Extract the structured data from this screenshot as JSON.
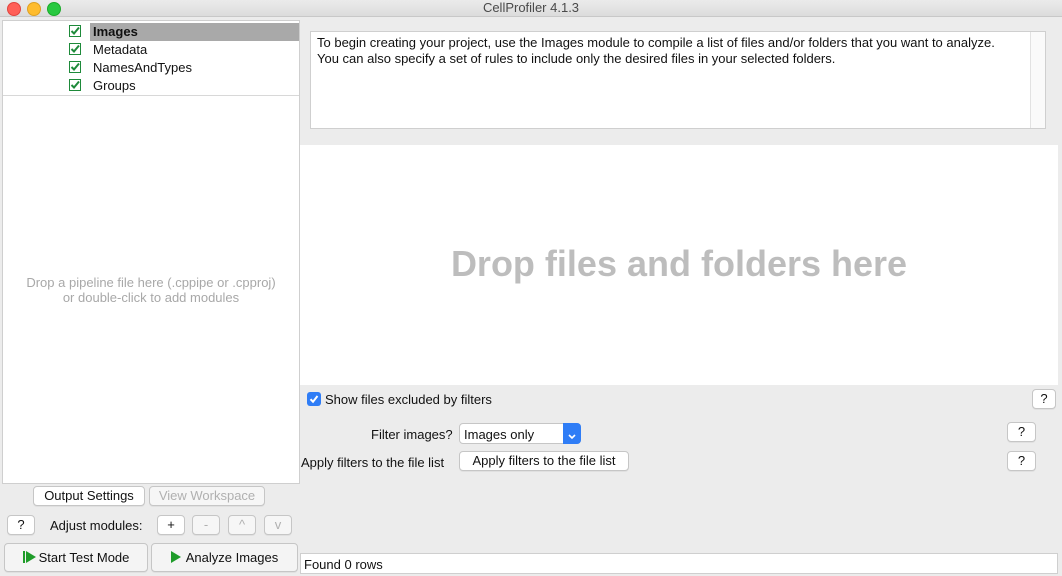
{
  "window": {
    "title": "CellProfiler 4.1.3"
  },
  "modules": [
    {
      "label": "Images",
      "selected": true
    },
    {
      "label": "Metadata",
      "selected": false
    },
    {
      "label": "NamesAndTypes",
      "selected": false
    },
    {
      "label": "Groups",
      "selected": false
    }
  ],
  "pipeline": {
    "drop_line1": "Drop a pipeline file here (.cppipe or .cpproj)",
    "drop_line2": "or double-click to add modules"
  },
  "left_buttons": {
    "output_settings": "Output Settings",
    "view_workspace": "View Workspace",
    "help": "?",
    "adjust_label": "Adjust modules:",
    "add": "+",
    "remove": "-",
    "move_up": "^",
    "move_down": "v",
    "start_test_mode": "Start Test Mode",
    "analyze_images": "Analyze Images"
  },
  "module_panel": {
    "info_text": "To begin creating your project, use the Images module to compile a list of files and/or folders that you want to analyze. You can also specify a set of rules to include only the desired files in your selected folders.",
    "drop_text": "Drop files and folders here",
    "show_excluded_label": "Show files excluded by filters",
    "show_excluded_checked": true,
    "filter_images_label": "Filter images?",
    "filter_images_value": "Images only",
    "apply_filters_label": "Apply filters to the file list",
    "apply_filters_button": "Apply filters to the file list",
    "help": "?"
  },
  "status": {
    "text": "Found 0 rows"
  },
  "colors": {
    "accent": "#2f7df6",
    "selection": "#a9a9a9",
    "run_green": "#1f9c2a",
    "check_green": "#1e8a3a"
  },
  "icons": {
    "module_check": "check-icon",
    "test_mode": "step-play-icon",
    "analyze": "play-icon",
    "dropdown": "chevron-updown-icon"
  }
}
